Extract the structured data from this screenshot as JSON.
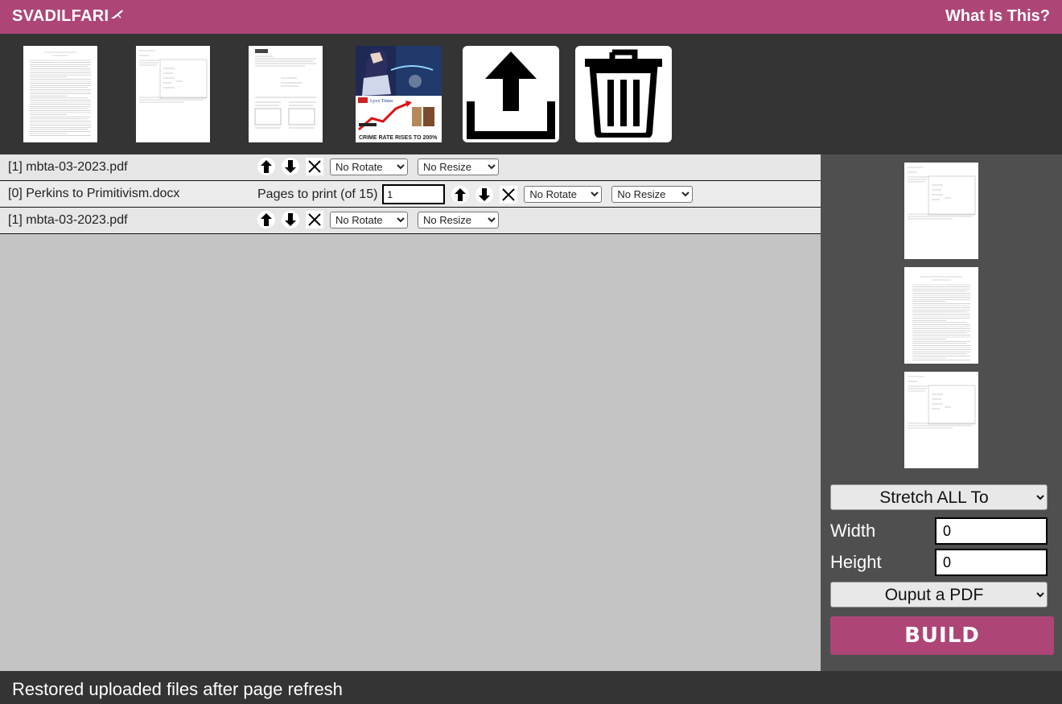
{
  "app": {
    "brand": "SVADILFARI",
    "help_link": "What Is This?"
  },
  "file_strip": {
    "thumbnails": [
      "document-page-thumbnail",
      "form-page-thumbnail",
      "report-page-thumbnail",
      "image-thumbnail"
    ],
    "image_caption_top": "Lyox Times",
    "image_caption_bottom": "CRIME RATE RISES TO 200%",
    "upload_icon": "upload-icon",
    "trash_icon": "trash-icon"
  },
  "jobs": [
    {
      "label": "[1] mbta-03-2023.pdf",
      "rotate": "No Rotate",
      "resize": "No Resize"
    },
    {
      "label": "[0] Perkins to Primitivism.docx",
      "pages_label": "Pages to print (of 15)",
      "pages_value": "1",
      "rotate": "No Rotate",
      "resize": "No Resize"
    },
    {
      "label": "[1] mbta-03-2023.pdf",
      "rotate": "No Rotate",
      "resize": "No Resize"
    }
  ],
  "options": {
    "rotate": [
      "No Rotate"
    ],
    "resize": [
      "No Resize"
    ]
  },
  "sidebar": {
    "stretch_label": "Stretch ALL To",
    "width_label": "Width",
    "width_value": "0",
    "height_label": "Height",
    "height_value": "0",
    "output_label": "Ouput a PDF",
    "build_label": "BUILD"
  },
  "status": {
    "text": "Restored uploaded files after page refresh"
  },
  "colors": {
    "accent": "#ad4577",
    "dark": "#343434",
    "panel": "#4f4f4f",
    "list_bg": "#c4c4c4"
  }
}
